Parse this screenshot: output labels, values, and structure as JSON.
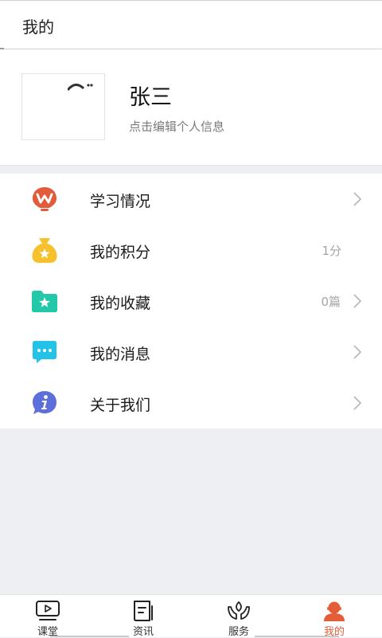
{
  "header": {
    "title": "我的"
  },
  "profile": {
    "name": "张三",
    "hint": "点击编辑个人信息",
    "avatar_icon": "avatar-icon"
  },
  "menu": [
    {
      "label": "学习情况",
      "value": "",
      "icon": "lightbulb-w-icon",
      "color": "#e25b3b",
      "arrow": true
    },
    {
      "label": "我的积分",
      "value": "1分",
      "icon": "money-bag-icon",
      "color": "#f5c12c",
      "arrow": false
    },
    {
      "label": "我的收藏",
      "value": "0篇",
      "icon": "star-folder-icon",
      "color": "#22c8a8",
      "arrow": true
    },
    {
      "label": "我的消息",
      "value": "",
      "icon": "chat-bubble-icon",
      "color": "#22c3e6",
      "arrow": true
    },
    {
      "label": "关于我们",
      "value": "",
      "icon": "info-icon",
      "color": "#5d6fd9",
      "arrow": true
    }
  ],
  "tabs": [
    {
      "label": "课堂",
      "icon": "play-screen-icon"
    },
    {
      "label": "资讯",
      "icon": "news-doc-icon"
    },
    {
      "label": "服务",
      "icon": "hands-leaf-icon"
    },
    {
      "label": "我的",
      "icon": "person-icon",
      "active": true
    }
  ],
  "colors": {
    "accent": "#e35d37",
    "background": "#eeeff3"
  }
}
